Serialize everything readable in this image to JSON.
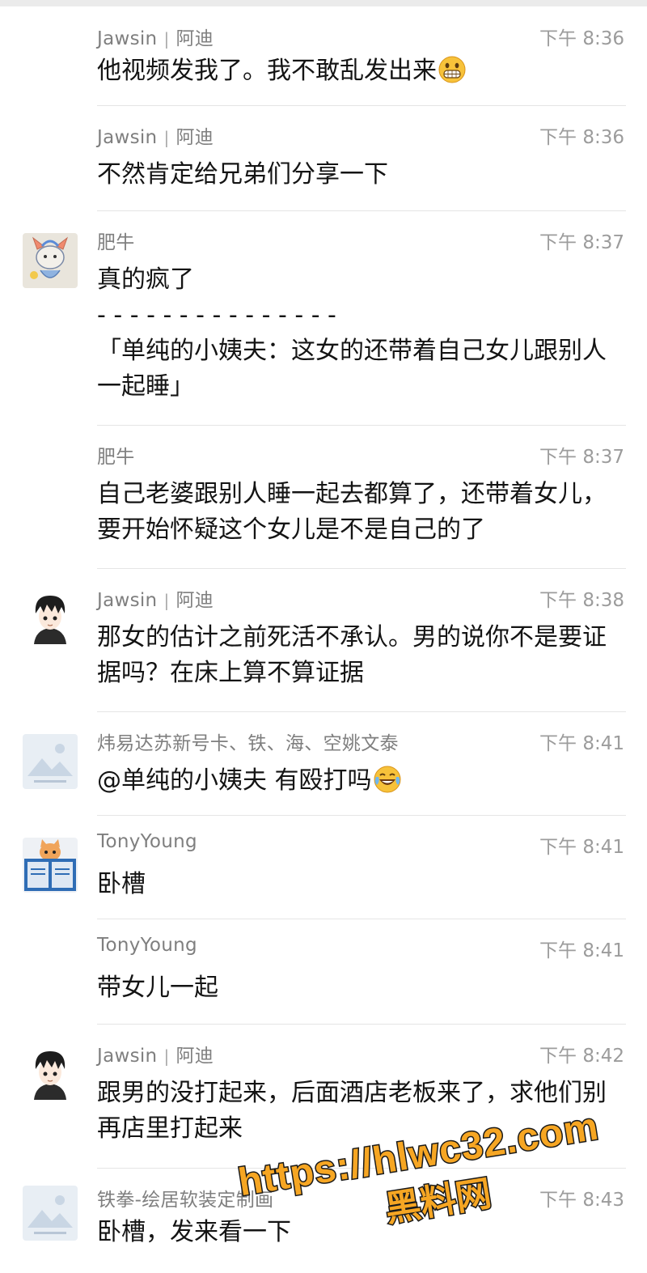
{
  "messages": [
    {
      "sender": "Jawsin",
      "sender_tag": "阿迪",
      "time": "下午 8:36",
      "text": "他视频发我了。我不敢乱发出来",
      "emoji": "grin-emoji"
    },
    {
      "sender": "Jawsin",
      "sender_tag": "阿迪",
      "time": "下午 8:36",
      "text": "不然肯定给兄弟们分享一下"
    },
    {
      "sender": "肥牛",
      "time": "下午 8:37",
      "text": "真的疯了\n- - - - - - - - - - - - - - -\n「单纯的小姨夫：这女的还带着自己女儿跟别人一起睡」",
      "avatar": "drawing-avatar"
    },
    {
      "sender": "肥牛",
      "time": "下午 8:37",
      "text": "自己老婆跟别人睡一起去都算了，还带着女儿，要开始怀疑这个女儿是不是自己的了"
    },
    {
      "sender": "Jawsin",
      "sender_tag": "阿迪",
      "time": "下午 8:38",
      "text": "那女的估计之前死活不承认。男的说你不是要证据吗？在床上算不算证据",
      "avatar": "anime-boy-avatar"
    },
    {
      "sender": "炜易达苏新号卡、铁、海、空姚文泰",
      "time": "下午 8:41",
      "text": "@单纯的小姨夫 有殴打吗",
      "emoji": "laugh-tears-emoji",
      "avatar": "placeholder-avatar"
    },
    {
      "sender": "TonyYoung",
      "time": "下午 8:41",
      "text": "卧槽",
      "avatar": "book-cat-avatar"
    },
    {
      "sender": "TonyYoung",
      "time": "下午 8:41",
      "text": "带女儿一起"
    },
    {
      "sender": "Jawsin",
      "sender_tag": "阿迪",
      "time": "下午 8:42",
      "text": "跟男的没打起来，后面酒店老板来了，求他们别再店里打起来",
      "avatar": "anime-boy-avatar"
    },
    {
      "sender": "铁拳-绘居软装定制画",
      "time": "下午 8:43",
      "text": "卧槽，发来看一下",
      "avatar": "placeholder-avatar"
    }
  ],
  "watermark": {
    "line1": "https://hlwc32.com",
    "line2": "黑料网"
  },
  "colors": {
    "name": "#7f7f7f",
    "time": "#9c9c9c",
    "text": "#141414",
    "separator": "#e5e5e5",
    "watermark_fill": "#f6a623"
  }
}
